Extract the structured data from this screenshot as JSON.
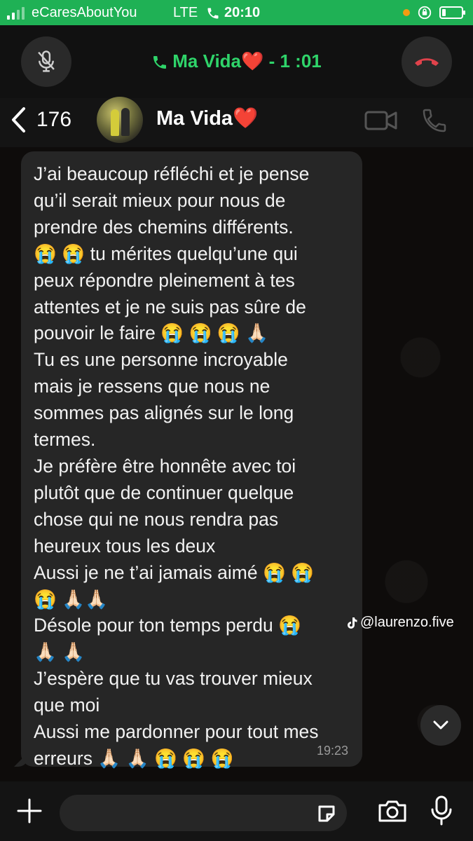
{
  "status_bar": {
    "carrier": "eCaresAboutYou",
    "network": "LTE",
    "time": "20:10",
    "signal_bars": 2,
    "battery_level": 0.2
  },
  "call": {
    "title": "Ma Vida❤️  - 1 :01"
  },
  "header": {
    "back_count": "176",
    "contact_name": "Ma Vida❤️"
  },
  "message": {
    "lines": [
      "J’ai beaucoup réfléchi et je pense",
      "qu’il serait mieux pour nous de",
      "prendre des chemins différents.",
      "😭 😭 tu mérites quelqu’une qui",
      "peux répondre pleinement à tes",
      "attentes et je ne suis pas sûre de",
      "pouvoir le faire 😭 😭 😭 🙏🏻",
      "Tu es une personne incroyable",
      "mais je ressens que nous ne",
      "sommes pas alignés sur le long",
      "termes.",
      "Je préfère être honnête avec toi",
      "plutôt que de continuer quelque",
      "chose qui ne nous rendra pas",
      "heureux tous les deux",
      "Aussi je ne t’ai jamais aimé 😭 😭",
      "😭 🙏🏻🙏🏻",
      "Désole pour ton temps perdu 😭",
      "🙏🏻 🙏🏻",
      "J’espère que tu vas trouver mieux",
      "que moi",
      "Aussi me pardonner pour tout mes",
      "erreurs 🙏🏻 🙏🏻 😭 😭 😭"
    ],
    "time": "19:23"
  },
  "watermark": "@laurenzo.five",
  "colors": {
    "status_green": "#1fb155",
    "call_green": "#2fd46a",
    "end_call_red": "#e0424b",
    "bubble": "#262626"
  },
  "icons": [
    "mic-muted-icon",
    "phone-icon",
    "end-call-icon",
    "chevron-left-icon",
    "video-call-icon",
    "voice-call-icon",
    "chevron-down-icon",
    "plus-icon",
    "sticker-icon",
    "camera-icon",
    "microphone-icon",
    "tiktok-icon"
  ]
}
